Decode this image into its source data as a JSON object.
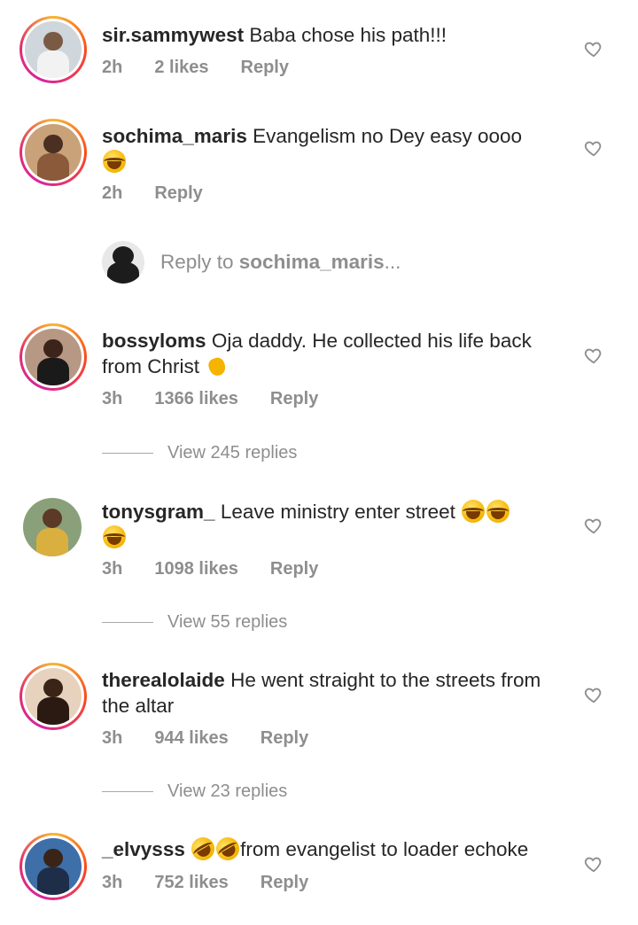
{
  "comments": [
    {
      "username": "sir.sammywest",
      "text": "Baba chose his path!!!",
      "time": "2h",
      "likes": "2 likes",
      "reply": "Reply"
    },
    {
      "username": "sochima_maris",
      "text": "Evangelism no Dey easy oooo",
      "time": "2h",
      "reply": "Reply"
    },
    {
      "username": "bossyloms",
      "text": "Oja daddy. He collected his life back from Christ",
      "time": "3h",
      "likes": "1366 likes",
      "reply": "Reply",
      "view_replies": "View 245 replies"
    },
    {
      "username": "tonysgram_",
      "text": "Leave ministry enter street",
      "time": "3h",
      "likes": "1098 likes",
      "reply": "Reply",
      "view_replies": "View 55 replies"
    },
    {
      "username": "therealolaide",
      "text": "He went straight to the streets from the altar",
      "time": "3h",
      "likes": "944 likes",
      "reply": "Reply",
      "view_replies": "View 23 replies"
    },
    {
      "username": "_elvysss",
      "text": "from evangelist to loader echoke",
      "time": "3h",
      "likes": "752 likes",
      "reply": "Reply"
    }
  ],
  "reply_input": {
    "prefix": "Reply to ",
    "target": "sochima_maris",
    "suffix": "..."
  },
  "icons": {
    "like": "heart-outline-icon",
    "laugh": "face-with-tears-of-joy-icon",
    "rofl": "rolling-on-floor-laughing-icon",
    "clap": "clapping-hands-icon"
  },
  "colors": {
    "text": "#262626",
    "secondary": "#8e8e8e",
    "story_ring_start": "#f7b733",
    "story_ring_end": "#d6249f"
  }
}
